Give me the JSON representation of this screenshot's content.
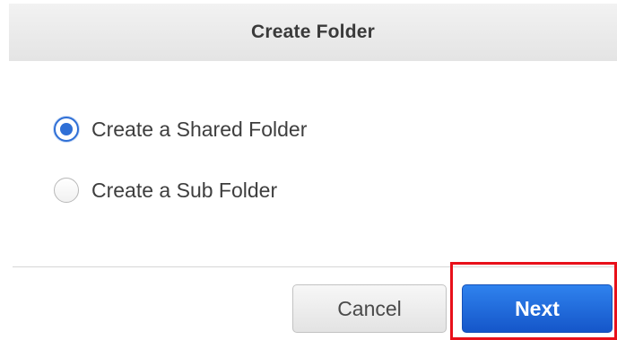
{
  "dialog": {
    "title": "Create Folder",
    "options": [
      {
        "label": "Create a Shared Folder",
        "selected": true
      },
      {
        "label": "Create a Sub Folder",
        "selected": false
      }
    ],
    "buttons": {
      "cancel_label": "Cancel",
      "next_label": "Next"
    }
  },
  "colors": {
    "accent": "#2f6fd6",
    "primary_button": "#1a63d8",
    "highlight": "#e8101a"
  }
}
